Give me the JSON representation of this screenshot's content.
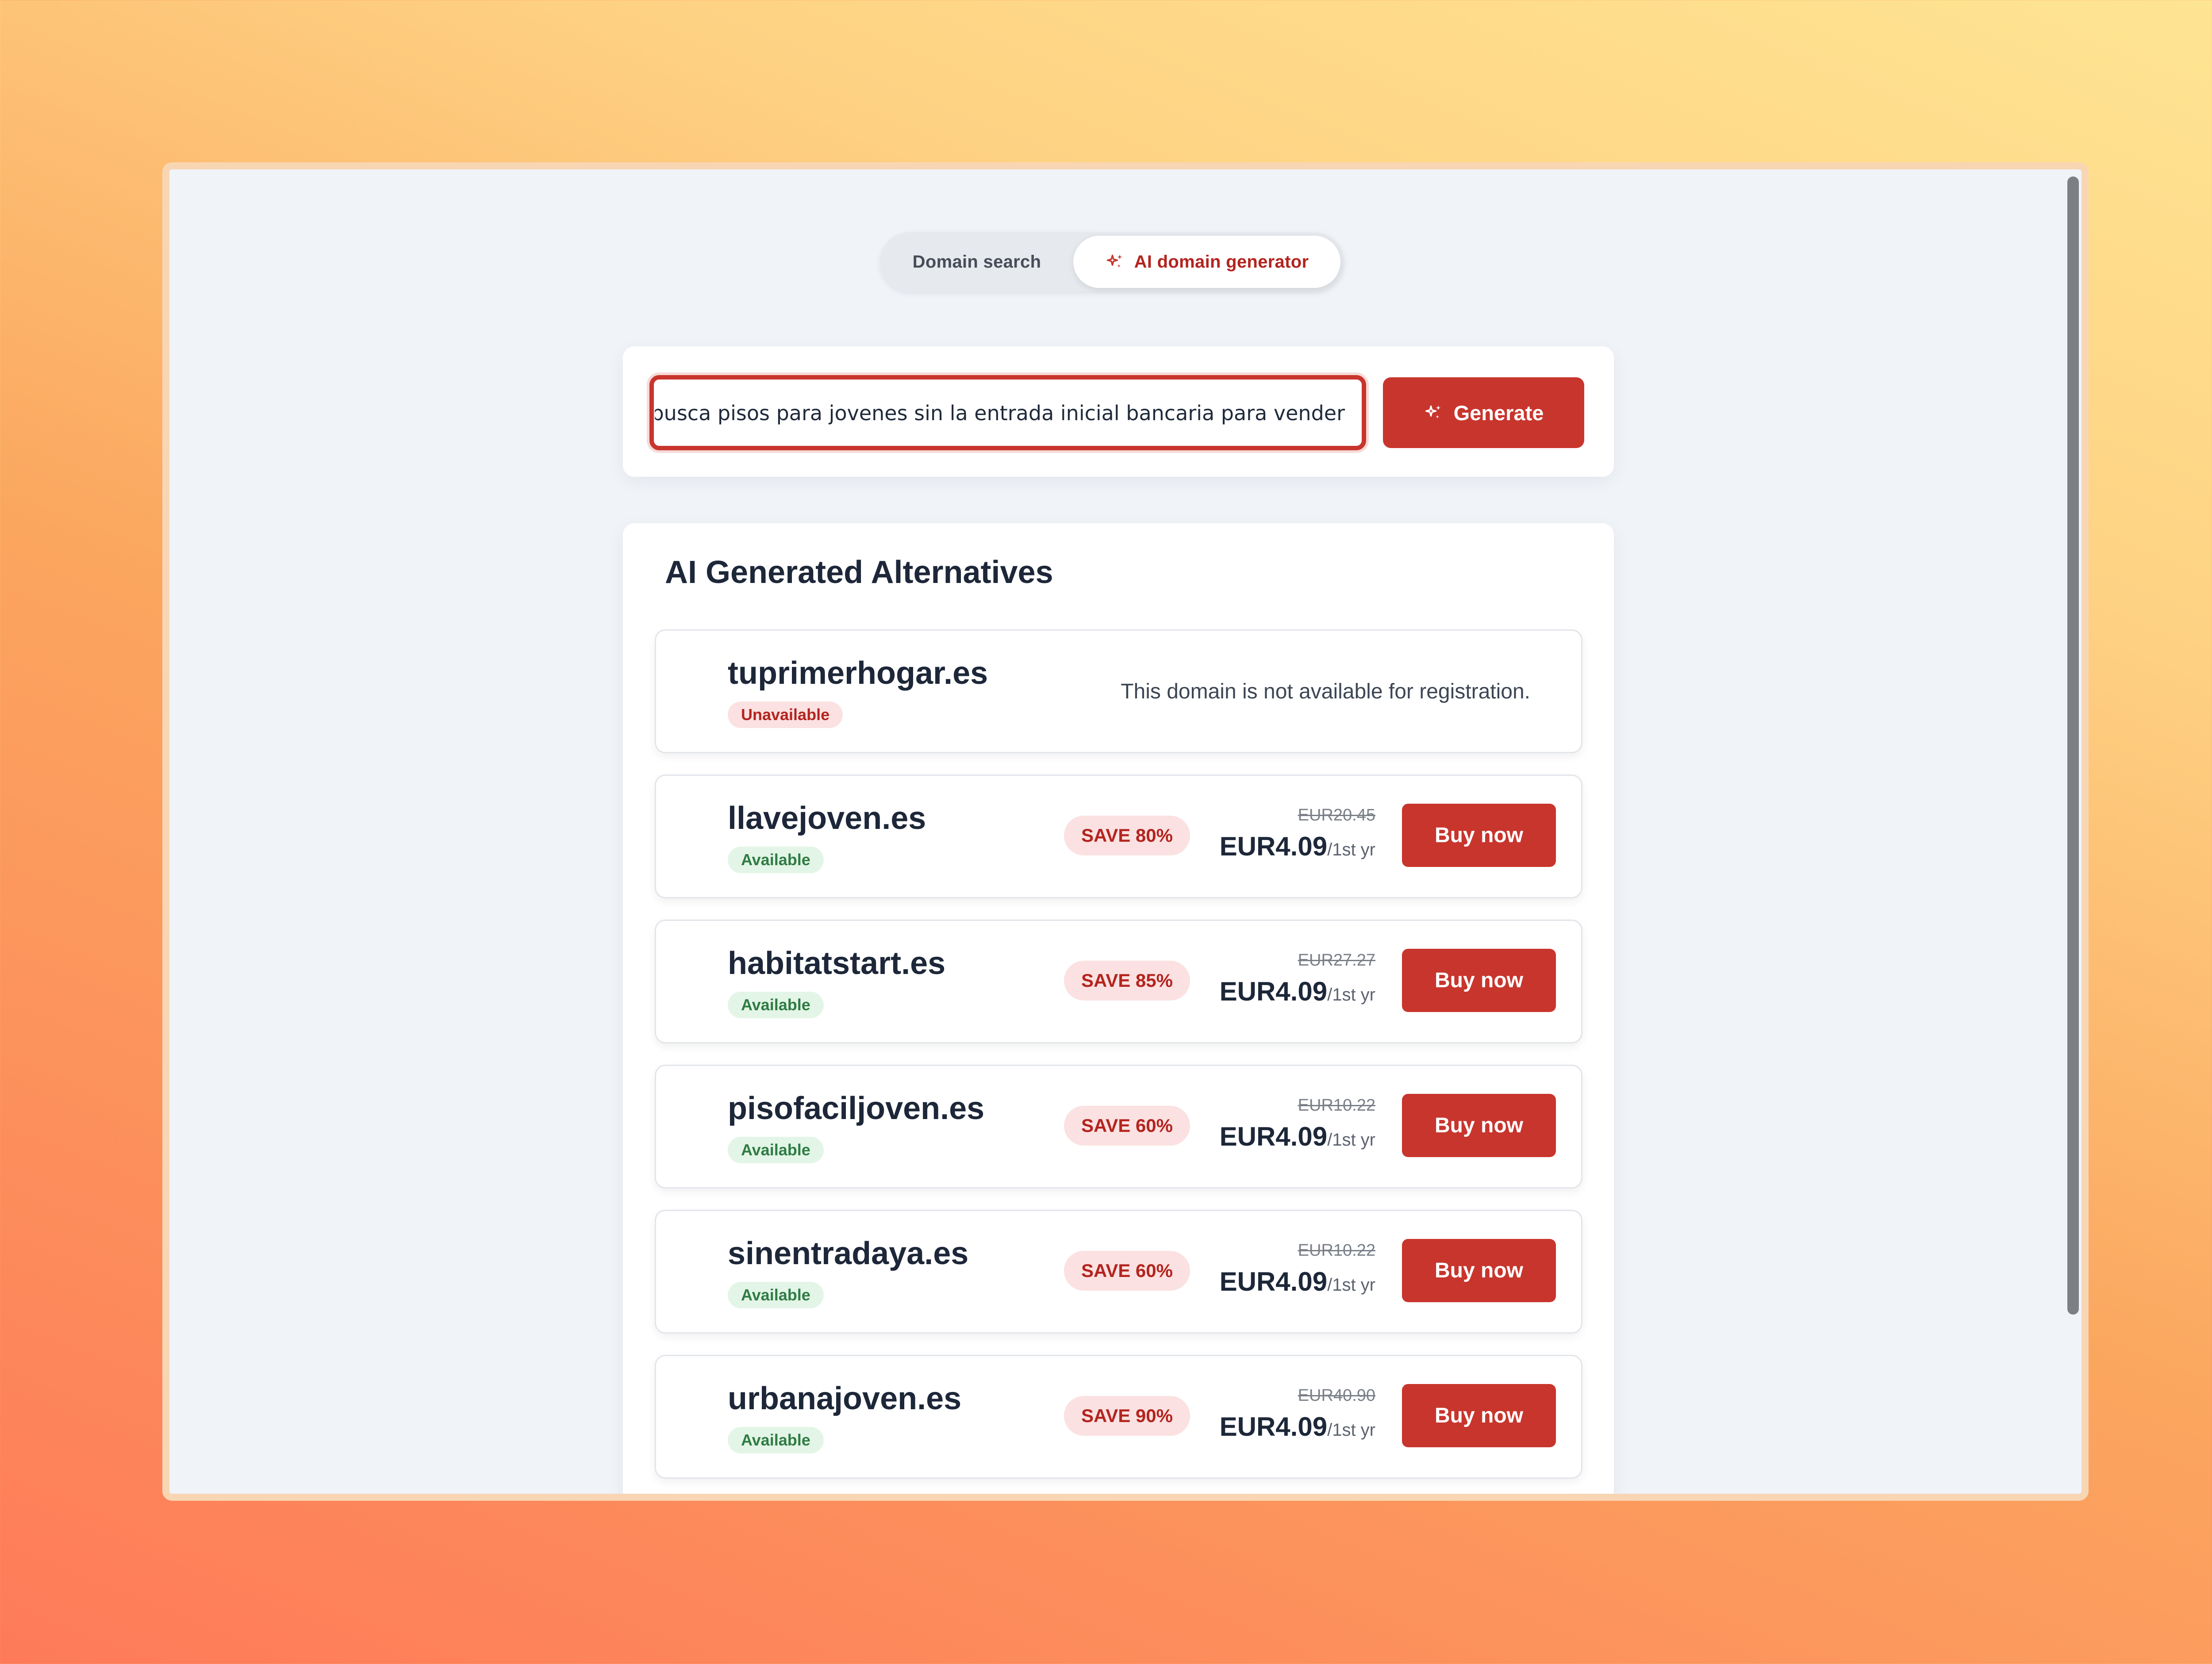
{
  "toggle": {
    "domain_search": "Domain search",
    "ai_generator": "AI domain generator"
  },
  "search": {
    "query": "empresa que busca pisos para jovenes sin la entrada inicial bancaria para vender",
    "generate_label": "Generate"
  },
  "results": {
    "title": "AI Generated Alternatives",
    "rows": [
      {
        "domain": "tuprimerhogar.es",
        "status": "Unavailable",
        "message": "This domain is not available for registration."
      },
      {
        "domain": "llavejoven.es",
        "status": "Available",
        "save": "SAVE 80%",
        "old_price": "EUR20.45",
        "price": "EUR4.09",
        "period": "/1st yr",
        "buy_label": "Buy now"
      },
      {
        "domain": "habitatstart.es",
        "status": "Available",
        "save": "SAVE 85%",
        "old_price": "EUR27.27",
        "price": "EUR4.09",
        "period": "/1st yr",
        "buy_label": "Buy now"
      },
      {
        "domain": "pisofaciljoven.es",
        "status": "Available",
        "save": "SAVE 60%",
        "old_price": "EUR10.22",
        "price": "EUR4.09",
        "period": "/1st yr",
        "buy_label": "Buy now"
      },
      {
        "domain": "sinentradaya.es",
        "status": "Available",
        "save": "SAVE 60%",
        "old_price": "EUR10.22",
        "price": "EUR4.09",
        "period": "/1st yr",
        "buy_label": "Buy now"
      },
      {
        "domain": "urbanajoven.es",
        "status": "Available",
        "save": "SAVE 90%",
        "old_price": "EUR40.90",
        "price": "EUR4.09",
        "period": "/1st yr",
        "buy_label": "Buy now"
      }
    ]
  },
  "colors": {
    "accent": "#c8352d",
    "available_text": "#2f7c44",
    "unavailable_text": "#b3241f"
  },
  "icons": {
    "toggle_ai": "sparkles-icon",
    "generate": "sparkles-icon"
  }
}
